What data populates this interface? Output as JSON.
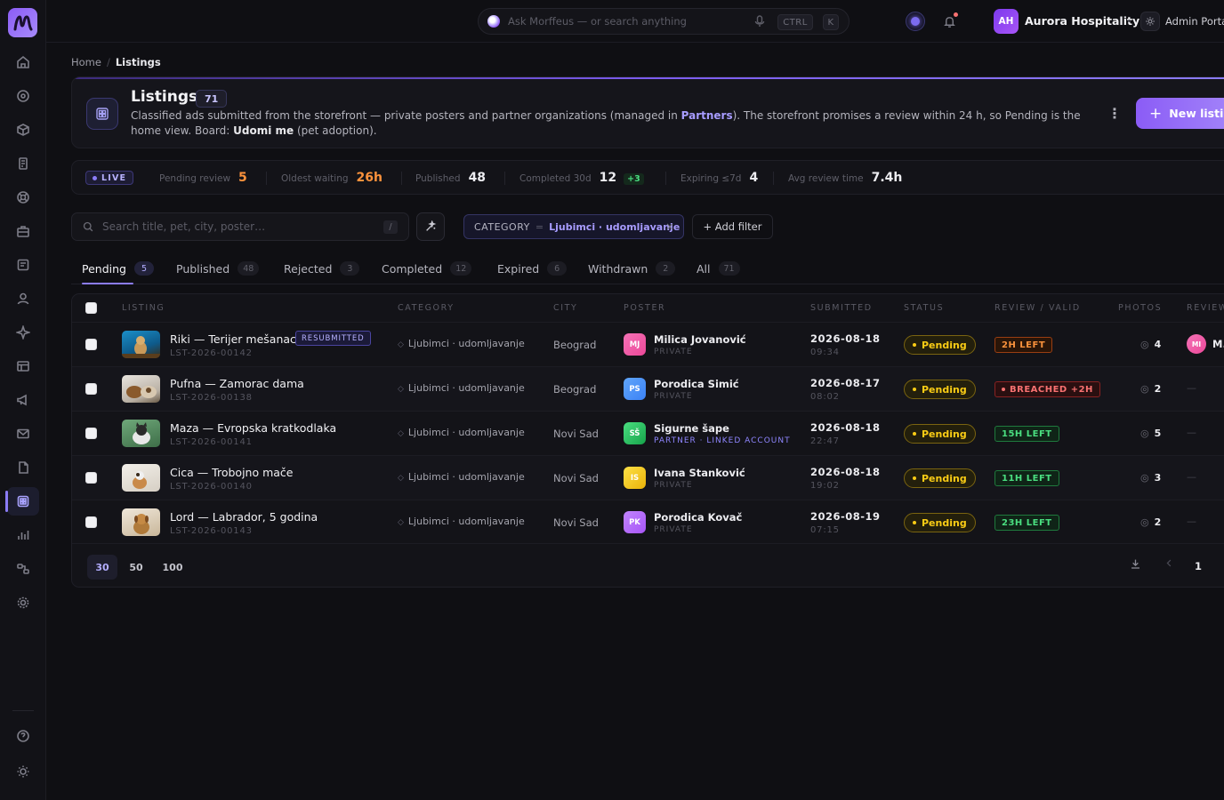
{
  "topbar": {
    "search_placeholder": "Ask Morffeus — or search anything",
    "kbd_ctrl": "CTRL",
    "kbd_k": "K",
    "org_initials": "AH",
    "org_name": "Aurora Hospitality",
    "admin_label": "Admin Portal"
  },
  "breadcrumb": {
    "home": "Home",
    "sep": "/",
    "current": "Listings"
  },
  "header": {
    "title": "Listings",
    "count": "71",
    "desc_part1": "Classified ads submitted from the storefront — private posters and partner organizations (managed in ",
    "desc_link": "Partners",
    "desc_part2": "). The storefront promises a review within 24 h, so Pending is the home view. Board: ",
    "desc_board": "Udomi me",
    "desc_part3": " (pet adoption).",
    "kebab": "⋮",
    "new_button": "New listing",
    "new_plus": "+"
  },
  "stats": {
    "live": "LIVE",
    "items": [
      {
        "label": "Pending review",
        "value": "5",
        "accent": true
      },
      {
        "label": "Oldest waiting",
        "value": "26h",
        "accent": true
      },
      {
        "label": "Published",
        "value": "48"
      },
      {
        "label": "Completed 30d",
        "value": "12",
        "delta": "+3"
      },
      {
        "label": "Expiring ≤7d",
        "value": "4"
      },
      {
        "label": "Avg review time",
        "value": "7.4h"
      }
    ]
  },
  "filters": {
    "search_placeholder": "Search title, pet, city, poster…",
    "slash": "/",
    "chip_key": "CATEGORY",
    "chip_eq": "=",
    "chip_value": "Ljubimci · udomljavanje",
    "chip_remove": "×",
    "add_filter": "+  Add filter"
  },
  "tabs": [
    {
      "label": "Pending",
      "count": "5"
    },
    {
      "label": "Published",
      "count": "48"
    },
    {
      "label": "Rejected",
      "count": "3"
    },
    {
      "label": "Completed",
      "count": "12"
    },
    {
      "label": "Expired",
      "count": "6"
    },
    {
      "label": "Withdrawn",
      "count": "2"
    },
    {
      "label": "All",
      "count": "71"
    }
  ],
  "table": {
    "headers": {
      "listing": "LISTING",
      "category": "CATEGORY",
      "city": "CITY",
      "poster": "POSTER",
      "submitted": "SUBMITTED",
      "status": "STATUS",
      "review": "REVIEW / VALID",
      "photos": "PHOTOS",
      "reviewer": "REVIEWER"
    },
    "rows": [
      {
        "title": "Riki — Terijer mešanac",
        "badge": "RESUBMITTED",
        "id": "LST-2026-00142",
        "category": "Ljubimci · udomljavanje",
        "city": "Beograd",
        "poster_initials": "MJ",
        "poster_name": "Milica Jovanović",
        "poster_type": "PRIVATE",
        "date": "2026-08-18",
        "time": "09:34",
        "status": "Pending",
        "review": "2H LEFT",
        "review_tone": "orange",
        "photos": "4",
        "reviewer_initials": "MI",
        "reviewer_name": "M."
      },
      {
        "title": "Pufna — Zamorac dama",
        "id": "LST-2026-00138",
        "category": "Ljubimci · udomljavanje",
        "city": "Beograd",
        "poster_initials": "PS",
        "poster_name": "Porodica Simić",
        "poster_type": "PRIVATE",
        "date": "2026-08-17",
        "time": "08:02",
        "status": "Pending",
        "review": "BREACHED +2H",
        "review_tone": "red",
        "photos": "2",
        "reviewer_empty": "—"
      },
      {
        "title": "Maza — Evropska kratkodlaka",
        "id": "LST-2026-00141",
        "category": "Ljubimci · udomljavanje",
        "city": "Novi Sad",
        "poster_initials": "SŠ",
        "poster_name": "Sigurne šape",
        "poster_type": "PARTNER · LINKED ACCOUNT",
        "date": "2026-08-18",
        "time": "22:47",
        "status": "Pending",
        "review": "15H LEFT",
        "review_tone": "green",
        "photos": "5",
        "reviewer_empty": "—"
      },
      {
        "title": "Cica — Trobojno mače",
        "id": "LST-2026-00140",
        "category": "Ljubimci · udomljavanje",
        "city": "Novi Sad",
        "poster_initials": "IS",
        "poster_name": "Ivana Stanković",
        "poster_type": "PRIVATE",
        "date": "2026-08-18",
        "time": "19:02",
        "status": "Pending",
        "review": "11H LEFT",
        "review_tone": "green",
        "photos": "3",
        "reviewer_empty": "—"
      },
      {
        "title": "Lord — Labrador, 5 godina",
        "id": "LST-2026-00143",
        "category": "Ljubimci · udomljavanje",
        "city": "Novi Sad",
        "poster_initials": "PK",
        "poster_name": "Porodica Kovač",
        "poster_type": "PRIVATE",
        "date": "2026-08-19",
        "time": "07:15",
        "status": "Pending",
        "review": "23H LEFT",
        "review_tone": "green",
        "photos": "2",
        "reviewer_empty": "—"
      }
    ]
  },
  "pagination": {
    "sizes": [
      "30",
      "50",
      "100"
    ],
    "page": "1"
  },
  "colors": {
    "accent": "#8b7cf6",
    "pending": "#facc15",
    "warning": "#fb923c",
    "danger": "#f87171",
    "ok": "#4ade80"
  }
}
